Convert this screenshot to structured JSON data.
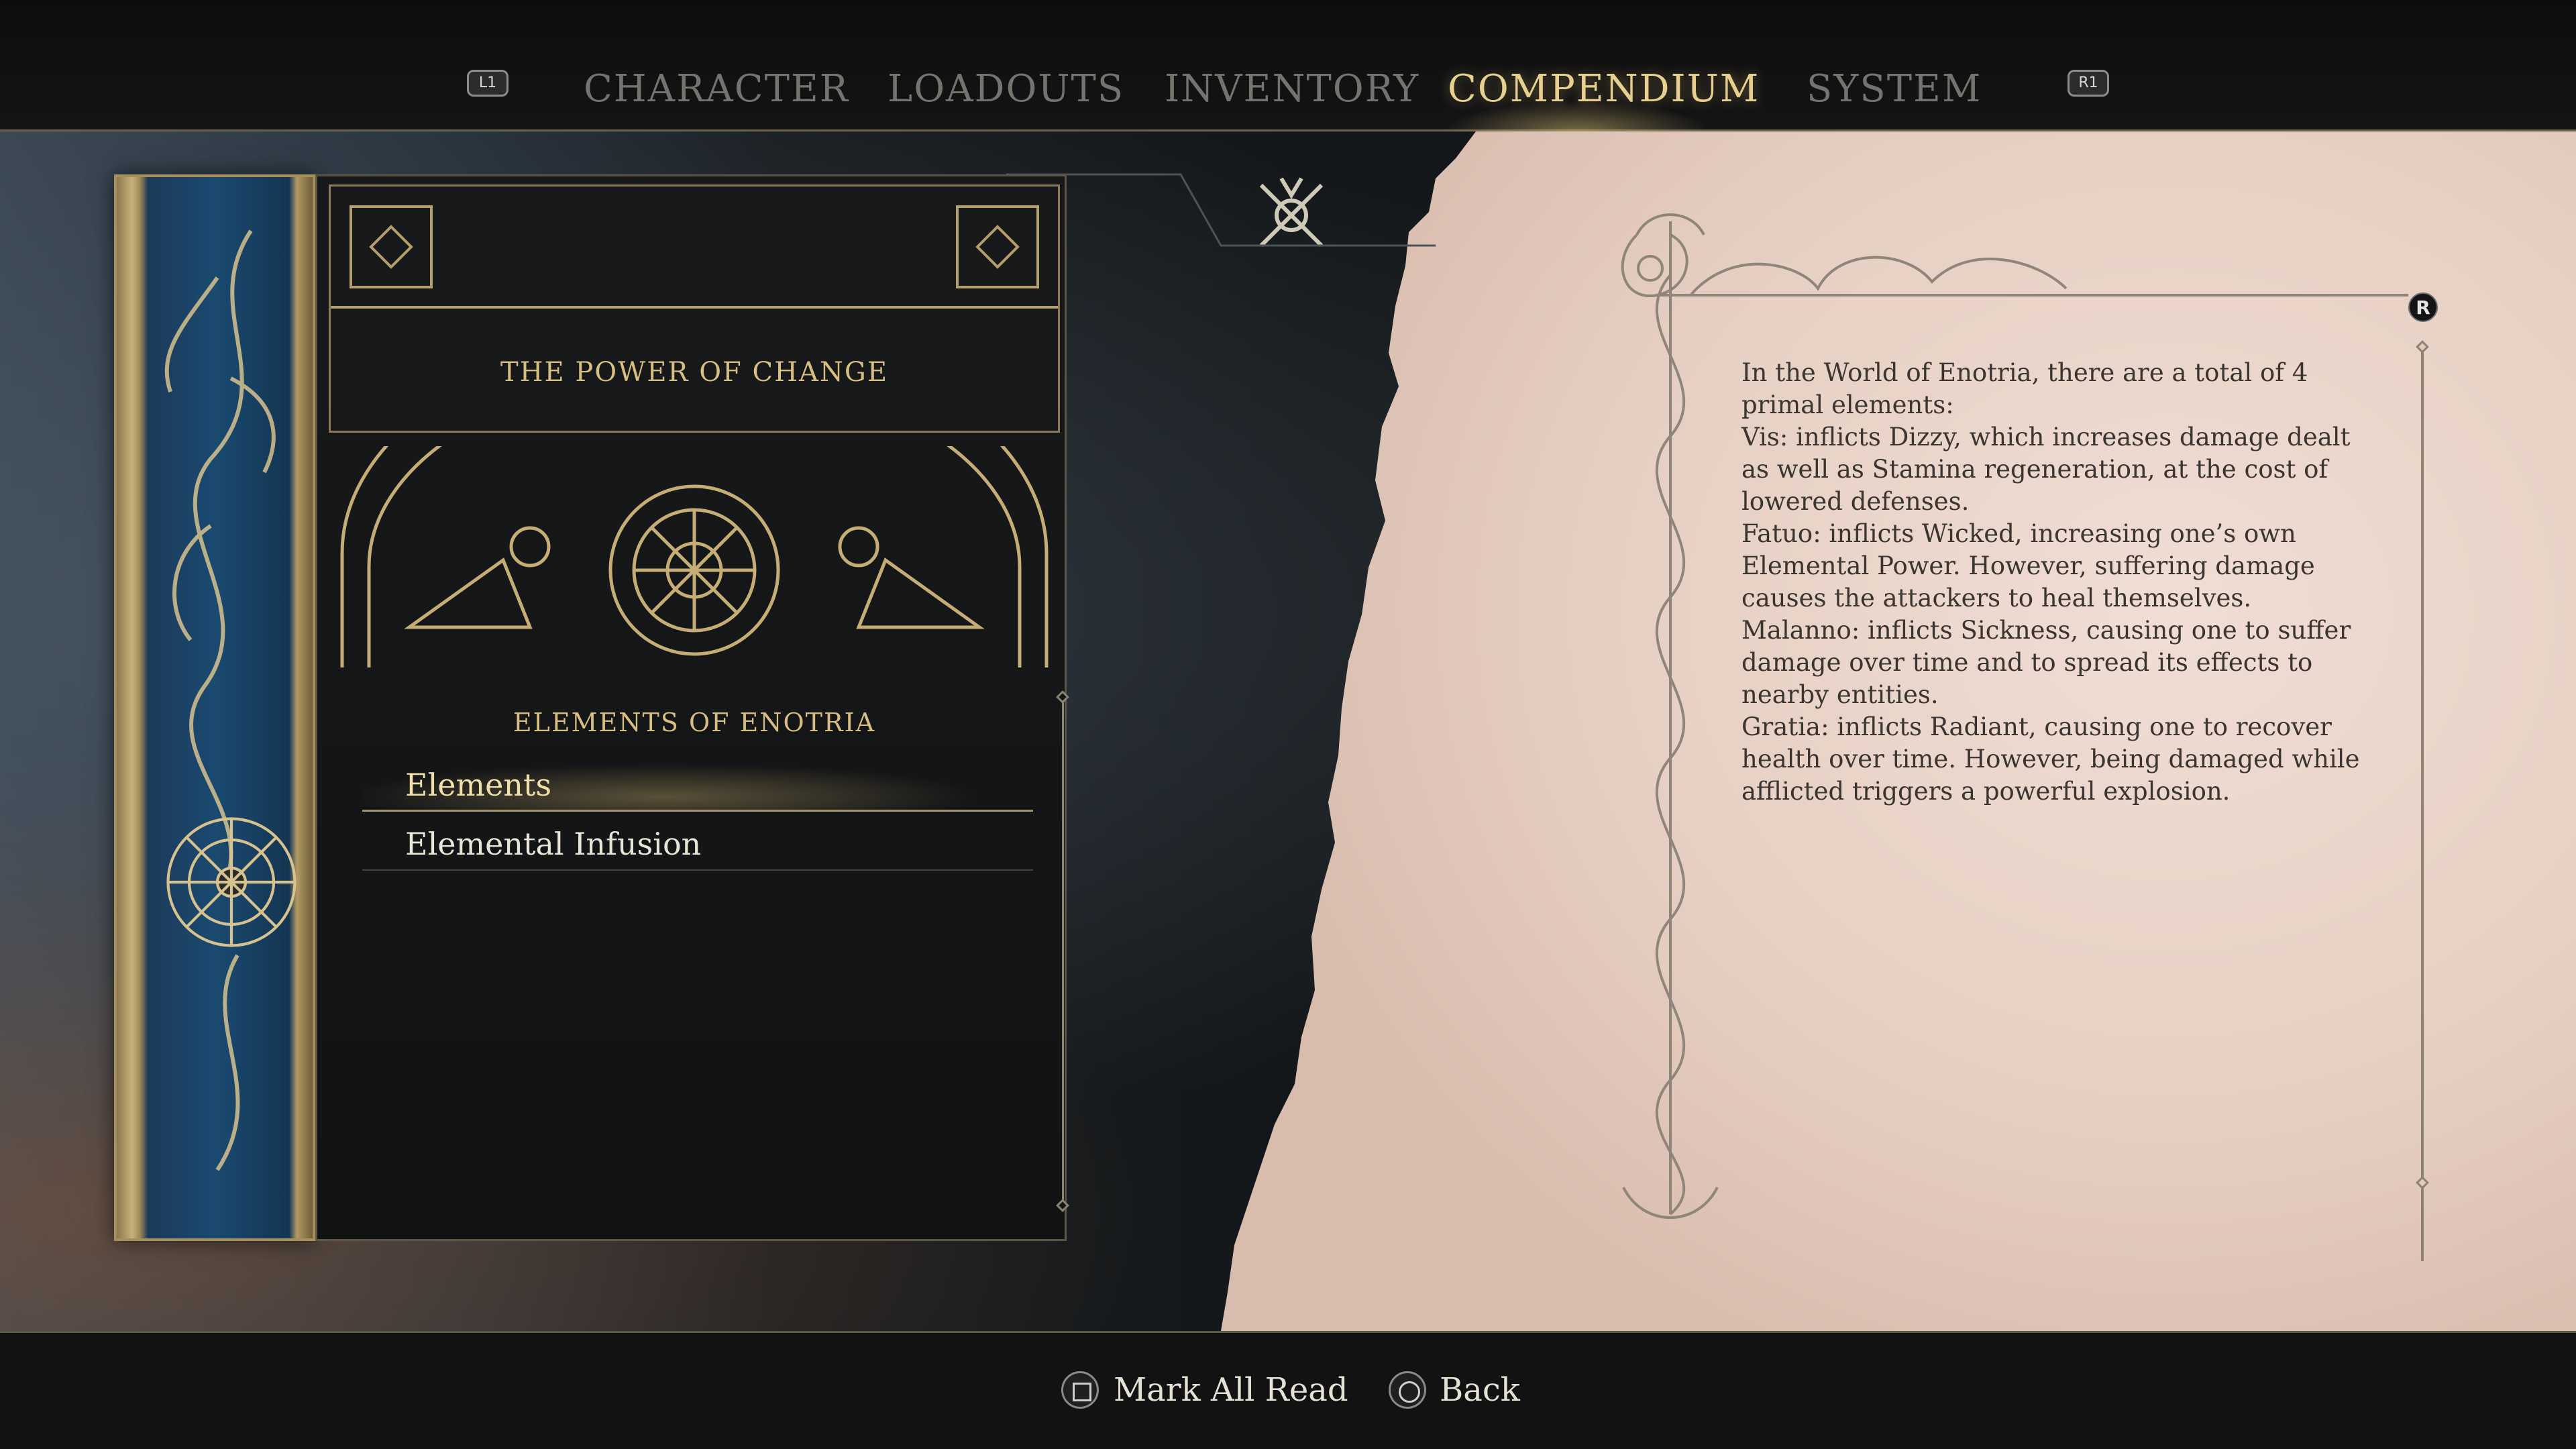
{
  "nav": {
    "left_shoulder": "L1",
    "right_shoulder": "R1",
    "tabs": [
      {
        "label": "CHARACTER",
        "active": false
      },
      {
        "label": "LOADOUTS",
        "active": false
      },
      {
        "label": "INVENTORY",
        "active": false
      },
      {
        "label": "COMPENDIUM",
        "active": true
      },
      {
        "label": "SYSTEM",
        "active": false
      }
    ]
  },
  "book": {
    "title": "THE POWER OF CHANGE",
    "section_title": "ELEMENTS OF ENOTRIA",
    "entries": [
      {
        "label": "Elements",
        "selected": true
      },
      {
        "label": "Elemental Infusion",
        "selected": false
      }
    ]
  },
  "lore": {
    "scroll_button": "R",
    "text": "In the World of Enotria, there are a total of 4 primal elements:\nVis: inflicts Dizzy, which increases damage dealt as well as Stamina regeneration, at the cost of lowered defenses.\nFatuo: inflicts Wicked, increasing one’s own Elemental Power. However, suffering damage causes the attackers to heal themselves.\nMalanno: inflicts Sickness, causing one to suffer damage over time and to spread its effects to nearby entities.\nGratia: inflicts Radiant, causing one to recover health over time. However, being damaged while afflicted triggers a powerful explosion."
  },
  "footer": {
    "mark_all_read": "Mark All Read",
    "back": "Back"
  },
  "colors": {
    "accent_gold": "#e6cf8f",
    "inactive_tab": "#75736e",
    "parchment": "#e8d2c6",
    "lore_text": "#3a3530"
  }
}
